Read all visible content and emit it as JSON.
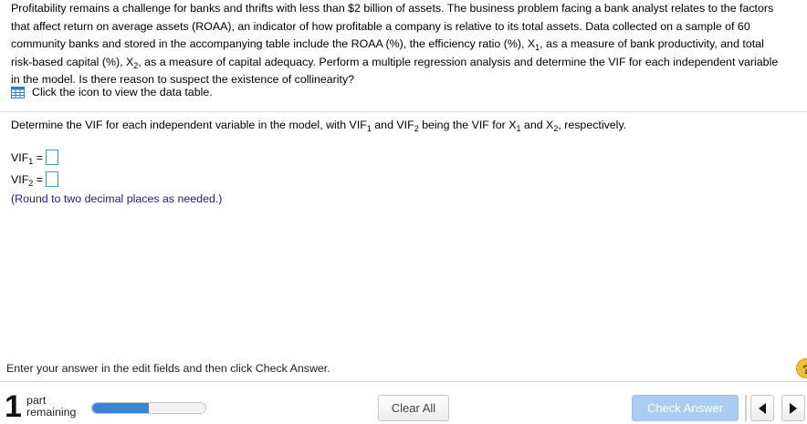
{
  "question": {
    "intro": "Profitability remains a challenge for banks and thrifts with less than $2 billion of assets. The business problem facing a bank analyst relates to the factors that affect return on average assets (ROAA), an indicator of how profitable a company is relative to its total assets. Data collected on a sample of 60 community banks and stored in the accompanying table include the ROAA (%), the efficiency ratio (%), X",
    "x1_sub": "1",
    "mid": ", as a measure of bank productivity, and total risk-based capital (%), X",
    "x2_sub": "2",
    "end": ", as a measure of capital adequacy. Perform a multiple regression analysis and determine the VIF for each independent variable in the model. Is there reason to suspect the existence of collinearity?"
  },
  "data_link": {
    "label": "Click the icon to view the data table.",
    "icon": "table-icon"
  },
  "prompt": {
    "p1": "Determine the VIF for each independent variable in the model, with VIF",
    "s1": "1",
    "p2": " and VIF",
    "s2": "2",
    "p3": " being the VIF for X",
    "s3": "1",
    "p4": " and X",
    "s4": "2",
    "p5": ", respectively."
  },
  "answers": {
    "vif1": {
      "label": "VIF",
      "sub": "1",
      "eq": " =",
      "value": ""
    },
    "vif2": {
      "label": "VIF",
      "sub": "2",
      "eq": " =",
      "value": ""
    }
  },
  "round_note": "(Round to two decimal places as needed.)",
  "instructions": "Enter your answer in the edit fields and then click Check Answer.",
  "help_label": "?",
  "footer": {
    "part_number": "1",
    "part_word": "part",
    "remaining_word": "remaining",
    "progress_fraction": 0.5,
    "clear_label": "Clear All",
    "check_label": "Check Answer"
  },
  "colors": {
    "accent": "#3b83d6",
    "link_blue": "#1a1aa6",
    "input_border": "#2fa6c9",
    "check_button": "#a9cdf0",
    "help": "#f0c030"
  }
}
